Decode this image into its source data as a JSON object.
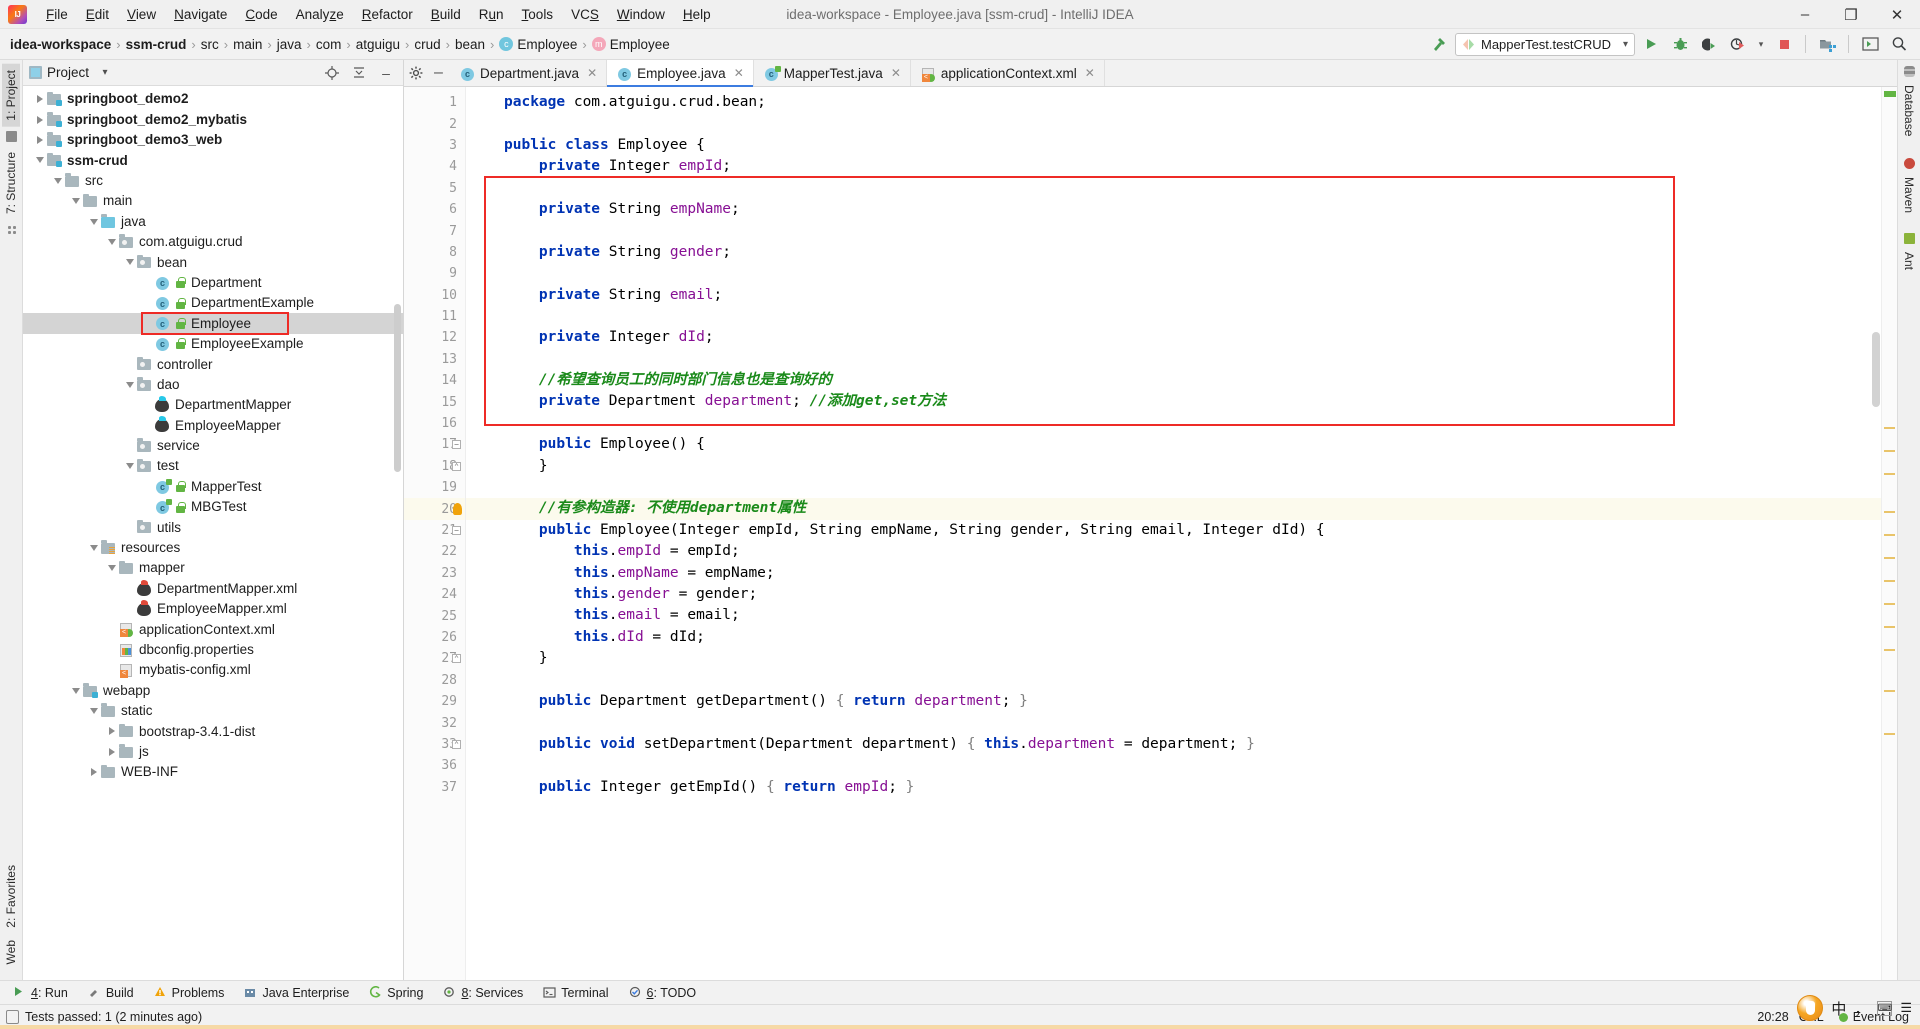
{
  "window": {
    "title": "idea-workspace - Employee.java [ssm-crud] - IntelliJ IDEA",
    "logo_alt": "intellij-idea-logo",
    "minimize": "–",
    "maximize": "❐",
    "close": "✕"
  },
  "menu": [
    {
      "label": "File"
    },
    {
      "label": "Edit"
    },
    {
      "label": "View"
    },
    {
      "label": "Navigate"
    },
    {
      "label": "Code"
    },
    {
      "label": "Analyze"
    },
    {
      "label": "Refactor"
    },
    {
      "label": "Build"
    },
    {
      "label": "Run"
    },
    {
      "label": "Tools"
    },
    {
      "label": "VCS"
    },
    {
      "label": "Window"
    },
    {
      "label": "Help"
    }
  ],
  "breadcrumbs": [
    {
      "label": "idea-workspace",
      "bold": true,
      "icon": null
    },
    {
      "label": "ssm-crud",
      "bold": true,
      "icon": null
    },
    {
      "label": "src",
      "bold": false,
      "icon": null
    },
    {
      "label": "main",
      "bold": false,
      "icon": null
    },
    {
      "label": "java",
      "bold": false,
      "icon": null
    },
    {
      "label": "com",
      "bold": false,
      "icon": null
    },
    {
      "label": "atguigu",
      "bold": false,
      "icon": null
    },
    {
      "label": "crud",
      "bold": false,
      "icon": null
    },
    {
      "label": "bean",
      "bold": false,
      "icon": null
    },
    {
      "label": "Employee",
      "bold": false,
      "icon": "class-icon",
      "glyph": "c"
    },
    {
      "label": "Employee",
      "bold": false,
      "icon": "method-icon",
      "glyph": "m"
    }
  ],
  "toolbar": {
    "run_config": "MapperTest.testCRUD",
    "run_config_icon": "run-config-icon",
    "dropdown_caret": "▾",
    "hammer_icon": "build-hammer-icon",
    "run_icon": "▶",
    "debug_icon": "debug-icon",
    "coverage_icon": "run-with-coverage-icon",
    "profile_icon": "profiler-icon",
    "stop_icon": "stop-icon",
    "project_structure_icon": "project-structure-icon",
    "layout_icon": "layout-icon",
    "search_icon": "⌕"
  },
  "left_rail": {
    "top": [
      {
        "label": "1: Project",
        "icon": "project-icon",
        "active": true
      },
      {
        "label": "7: Structure",
        "icon": "structure-icon",
        "active": false
      }
    ],
    "bottom": [
      {
        "label": "2: Favorites",
        "icon": "favorites-icon"
      },
      {
        "label": "Web",
        "icon": "web-icon"
      }
    ]
  },
  "right_rail": [
    {
      "label": "Database",
      "icon": "database-icon"
    },
    {
      "label": "Maven",
      "icon": "maven-icon"
    },
    {
      "label": "Ant",
      "icon": "ant-icon"
    }
  ],
  "project_panel": {
    "title": "Project",
    "title_caret": "▾",
    "target_icon": "scroll-from-source-icon",
    "collapse_icon": "collapse-all-icon",
    "hide_icon": "hide-icon",
    "highlighted_node": "Employee",
    "tree": [
      {
        "label": "springboot_demo2",
        "depth": 1,
        "twisty": "right",
        "icon": "module-folder-icon",
        "bold": true
      },
      {
        "label": "springboot_demo2_mybatis",
        "depth": 1,
        "twisty": "right",
        "icon": "module-folder-icon",
        "bold": true
      },
      {
        "label": "springboot_demo3_web",
        "depth": 1,
        "twisty": "right",
        "icon": "module-folder-icon",
        "bold": true
      },
      {
        "label": "ssm-crud",
        "depth": 1,
        "twisty": "down",
        "icon": "module-folder-icon",
        "bold": true
      },
      {
        "label": "src",
        "depth": 2,
        "twisty": "down",
        "icon": "folder-icon",
        "bold": false
      },
      {
        "label": "main",
        "depth": 3,
        "twisty": "down",
        "icon": "folder-icon",
        "bold": false
      },
      {
        "label": "java",
        "depth": 4,
        "twisty": "down",
        "icon": "source-folder-icon",
        "bold": false
      },
      {
        "label": "com.atguigu.crud",
        "depth": 5,
        "twisty": "down",
        "icon": "package-icon",
        "bold": false
      },
      {
        "label": "bean",
        "depth": 6,
        "twisty": "down",
        "icon": "package-icon",
        "bold": false
      },
      {
        "label": "Department",
        "depth": 7,
        "twisty": "none",
        "icon": "java-class-icon",
        "bold": false,
        "lock": true
      },
      {
        "label": "DepartmentExample",
        "depth": 7,
        "twisty": "none",
        "icon": "java-class-icon",
        "bold": false,
        "lock": true
      },
      {
        "label": "Employee",
        "depth": 7,
        "twisty": "none",
        "icon": "java-class-icon",
        "bold": false,
        "lock": true,
        "selected": true
      },
      {
        "label": "EmployeeExample",
        "depth": 7,
        "twisty": "none",
        "icon": "java-class-icon",
        "bold": false,
        "lock": true
      },
      {
        "label": "controller",
        "depth": 6,
        "twisty": "none",
        "icon": "package-icon",
        "bold": false
      },
      {
        "label": "dao",
        "depth": 6,
        "twisty": "down",
        "icon": "package-icon",
        "bold": false
      },
      {
        "label": "DepartmentMapper",
        "depth": 7,
        "twisty": "none",
        "icon": "java-interface-icon",
        "bold": false
      },
      {
        "label": "EmployeeMapper",
        "depth": 7,
        "twisty": "none",
        "icon": "java-interface-icon",
        "bold": false
      },
      {
        "label": "service",
        "depth": 6,
        "twisty": "none",
        "icon": "package-icon",
        "bold": false
      },
      {
        "label": "test",
        "depth": 6,
        "twisty": "down",
        "icon": "package-icon",
        "bold": false
      },
      {
        "label": "MapperTest",
        "depth": 7,
        "twisty": "none",
        "icon": "test-class-icon",
        "bold": false,
        "lock": true
      },
      {
        "label": "MBGTest",
        "depth": 7,
        "twisty": "none",
        "icon": "test-class-icon",
        "bold": false,
        "lock": true
      },
      {
        "label": "utils",
        "depth": 6,
        "twisty": "none",
        "icon": "package-icon",
        "bold": false
      },
      {
        "label": "resources",
        "depth": 4,
        "twisty": "down",
        "icon": "resources-folder-icon",
        "bold": false
      },
      {
        "label": "mapper",
        "depth": 5,
        "twisty": "down",
        "icon": "folder-icon",
        "bold": false
      },
      {
        "label": "DepartmentMapper.xml",
        "depth": 6,
        "twisty": "none",
        "icon": "mybatis-xml-icon",
        "bold": false
      },
      {
        "label": "EmployeeMapper.xml",
        "depth": 6,
        "twisty": "none",
        "icon": "mybatis-xml-icon",
        "bold": false
      },
      {
        "label": "applicationContext.xml",
        "depth": 5,
        "twisty": "none",
        "icon": "spring-xml-icon",
        "bold": false
      },
      {
        "label": "dbconfig.properties",
        "depth": 5,
        "twisty": "none",
        "icon": "properties-icon",
        "bold": false
      },
      {
        "label": "mybatis-config.xml",
        "depth": 5,
        "twisty": "none",
        "icon": "xml-icon",
        "bold": false
      },
      {
        "label": "webapp",
        "depth": 3,
        "twisty": "down",
        "icon": "webapp-folder-icon",
        "bold": false
      },
      {
        "label": "static",
        "depth": 4,
        "twisty": "down",
        "icon": "folder-icon",
        "bold": false
      },
      {
        "label": "bootstrap-3.4.1-dist",
        "depth": 5,
        "twisty": "right",
        "icon": "folder-icon",
        "bold": false
      },
      {
        "label": "js",
        "depth": 5,
        "twisty": "right",
        "icon": "folder-icon",
        "bold": false
      },
      {
        "label": "WEB-INF",
        "depth": 4,
        "twisty": "right",
        "icon": "folder-icon",
        "bold": false
      }
    ]
  },
  "editor": {
    "tabs": [
      {
        "label": "Department.java",
        "icon": "java-class-icon",
        "active": false,
        "close": "✕"
      },
      {
        "label": "Employee.java",
        "icon": "java-class-icon",
        "active": true,
        "close": "✕"
      },
      {
        "label": "MapperTest.java",
        "icon": "test-class-icon",
        "active": false,
        "close": "✕"
      },
      {
        "label": "applicationContext.xml",
        "icon": "spring-xml-icon",
        "active": false,
        "close": "✕"
      }
    ],
    "tab_settings_icon": "settings-gear-icon",
    "tab_hide_icon": "hide-icon",
    "current_line": 20,
    "lines": [
      {
        "n": 1,
        "tokens": [
          [
            "kw",
            "package"
          ],
          [
            "pl",
            " com.atguigu.crud.bean;"
          ]
        ]
      },
      {
        "n": 2,
        "tokens": []
      },
      {
        "n": 3,
        "tokens": [
          [
            "kw",
            "public class"
          ],
          [
            "ty",
            " Employee {"
          ]
        ]
      },
      {
        "n": 4,
        "tokens": [
          [
            "pl",
            "    "
          ],
          [
            "kw",
            "private"
          ],
          [
            "ty",
            " Integer "
          ],
          [
            "fld",
            "empId"
          ],
          [
            "pl",
            ";"
          ]
        ]
      },
      {
        "n": 5,
        "tokens": []
      },
      {
        "n": 6,
        "tokens": [
          [
            "pl",
            "    "
          ],
          [
            "kw",
            "private"
          ],
          [
            "ty",
            " String "
          ],
          [
            "fld",
            "empName"
          ],
          [
            "pl",
            ";"
          ]
        ]
      },
      {
        "n": 7,
        "tokens": []
      },
      {
        "n": 8,
        "tokens": [
          [
            "pl",
            "    "
          ],
          [
            "kw",
            "private"
          ],
          [
            "ty",
            " String "
          ],
          [
            "fld",
            "gender"
          ],
          [
            "pl",
            ";"
          ]
        ]
      },
      {
        "n": 9,
        "tokens": []
      },
      {
        "n": 10,
        "tokens": [
          [
            "pl",
            "    "
          ],
          [
            "kw",
            "private"
          ],
          [
            "ty",
            " String "
          ],
          [
            "fld",
            "email"
          ],
          [
            "pl",
            ";"
          ]
        ]
      },
      {
        "n": 11,
        "tokens": []
      },
      {
        "n": 12,
        "tokens": [
          [
            "pl",
            "    "
          ],
          [
            "kw",
            "private"
          ],
          [
            "ty",
            " Integer "
          ],
          [
            "fld",
            "dId"
          ],
          [
            "pl",
            ";"
          ]
        ]
      },
      {
        "n": 13,
        "tokens": []
      },
      {
        "n": 14,
        "tokens": [
          [
            "pl",
            "    "
          ],
          [
            "cm",
            "//希望查询员工的同时部门信息也是查询好的"
          ]
        ]
      },
      {
        "n": 15,
        "tokens": [
          [
            "pl",
            "    "
          ],
          [
            "kw",
            "private"
          ],
          [
            "ty",
            " Department "
          ],
          [
            "fld",
            "department"
          ],
          [
            "pl",
            "; "
          ],
          [
            "cm",
            "//添加get,set方法"
          ]
        ]
      },
      {
        "n": 16,
        "tokens": []
      },
      {
        "n": 17,
        "tokens": [
          [
            "pl",
            "    "
          ],
          [
            "kw",
            "public"
          ],
          [
            "ty",
            " "
          ],
          [
            "ty2",
            "Employee"
          ],
          [
            "pl",
            "() {"
          ]
        ],
        "fold": "open"
      },
      {
        "n": 18,
        "tokens": [
          [
            "pl",
            "    }"
          ]
        ],
        "fold": "close"
      },
      {
        "n": 19,
        "tokens": []
      },
      {
        "n": 20,
        "tokens": [
          [
            "pl",
            "    "
          ],
          [
            "cm",
            "//有参构造器: 不使用department属性"
          ]
        ],
        "current": true,
        "bulb": true
      },
      {
        "n": 21,
        "tokens": [
          [
            "pl",
            "    "
          ],
          [
            "kw",
            "public"
          ],
          [
            "ty",
            " "
          ],
          [
            "ty2",
            "Employee"
          ],
          [
            "pl",
            "(Integer empId, String empName, String gender, String email, Integer dId) {"
          ]
        ],
        "fold": "open"
      },
      {
        "n": 22,
        "tokens": [
          [
            "pl",
            "        "
          ],
          [
            "kw",
            "this"
          ],
          [
            "pl",
            "."
          ],
          [
            "fld",
            "empId"
          ],
          [
            "pl",
            " = empId;"
          ]
        ]
      },
      {
        "n": 23,
        "tokens": [
          [
            "pl",
            "        "
          ],
          [
            "kw",
            "this"
          ],
          [
            "pl",
            "."
          ],
          [
            "fld",
            "empName"
          ],
          [
            "pl",
            " = empName;"
          ]
        ]
      },
      {
        "n": 24,
        "tokens": [
          [
            "pl",
            "        "
          ],
          [
            "kw",
            "this"
          ],
          [
            "pl",
            "."
          ],
          [
            "fld",
            "gender"
          ],
          [
            "pl",
            " = gender;"
          ]
        ]
      },
      {
        "n": 25,
        "tokens": [
          [
            "pl",
            "        "
          ],
          [
            "kw",
            "this"
          ],
          [
            "pl",
            "."
          ],
          [
            "fld",
            "email"
          ],
          [
            "pl",
            " = email;"
          ]
        ]
      },
      {
        "n": 26,
        "tokens": [
          [
            "pl",
            "        "
          ],
          [
            "kw",
            "this"
          ],
          [
            "pl",
            "."
          ],
          [
            "fld",
            "dId"
          ],
          [
            "pl",
            " = dId;"
          ]
        ]
      },
      {
        "n": 27,
        "tokens": [
          [
            "pl",
            "    }"
          ]
        ],
        "fold": "close"
      },
      {
        "n": 28,
        "tokens": []
      },
      {
        "n": 29,
        "tokens": [
          [
            "pl",
            "    "
          ],
          [
            "kw",
            "public"
          ],
          [
            "ty",
            " Department "
          ],
          [
            "ty2",
            "getDepartment"
          ],
          [
            "pl",
            "() "
          ],
          [
            "fo",
            "{ "
          ],
          [
            "kw",
            "return"
          ],
          [
            "ty2",
            ""
          ],
          [
            "pl",
            " "
          ],
          [
            "fld",
            "department"
          ],
          [
            "pl",
            "; "
          ],
          [
            "fo",
            "}"
          ]
        ]
      },
      {
        "n": 32,
        "tokens": []
      },
      {
        "n": 33,
        "tokens": [
          [
            "pl",
            "    "
          ],
          [
            "kw",
            "public void"
          ],
          [
            "ty",
            " "
          ],
          [
            "ty2",
            "setDepartment"
          ],
          [
            "pl",
            "(Department department) "
          ],
          [
            "fo",
            "{ "
          ],
          [
            "kw",
            "this"
          ],
          [
            "pl",
            "."
          ],
          [
            "fld",
            "department"
          ],
          [
            "pl",
            " = department; "
          ],
          [
            "fo",
            "}"
          ]
        ],
        "fold": "close"
      },
      {
        "n": 36,
        "tokens": []
      },
      {
        "n": 37,
        "tokens": [
          [
            "pl",
            "    "
          ],
          [
            "kw",
            "public"
          ],
          [
            "ty",
            " Integer "
          ],
          [
            "ty2",
            "getEmpId"
          ],
          [
            "pl",
            "() "
          ],
          [
            "fo",
            "{ "
          ],
          [
            "kw",
            "return"
          ],
          [
            "pl",
            " "
          ],
          [
            "fld",
            "empId"
          ],
          [
            "pl",
            "; "
          ],
          [
            "fo",
            "}"
          ]
        ]
      }
    ]
  },
  "toolwindows": [
    {
      "label": "4: Run",
      "icon": "run-icon",
      "underline": "4"
    },
    {
      "label": "Build",
      "icon": "build-icon",
      "underline": ""
    },
    {
      "label": "Problems",
      "icon": "problems-icon",
      "underline": ""
    },
    {
      "label": "Java Enterprise",
      "icon": "java-enterprise-icon",
      "underline": ""
    },
    {
      "label": "Spring",
      "icon": "spring-icon",
      "underline": ""
    },
    {
      "label": "8: Services",
      "icon": "services-icon",
      "underline": "8"
    },
    {
      "label": "Terminal",
      "icon": "terminal-icon",
      "underline": ""
    },
    {
      "label": "6: TODO",
      "icon": "todo-icon",
      "underline": "6"
    }
  ],
  "statusbar": {
    "message": "Tests passed: 1 (2 minutes ago)",
    "message_icon": "test-status-icon",
    "time": "20:28",
    "line_separator": "CRL",
    "event_log": "Event Log",
    "event_log_icon": "event-log-icon",
    "ime_sogou": "sogou-input-icon",
    "ime_lang": "中",
    "ime_punct": "，",
    "ime_keyboard": "keyboard-icon",
    "ime_menu": "☰"
  }
}
